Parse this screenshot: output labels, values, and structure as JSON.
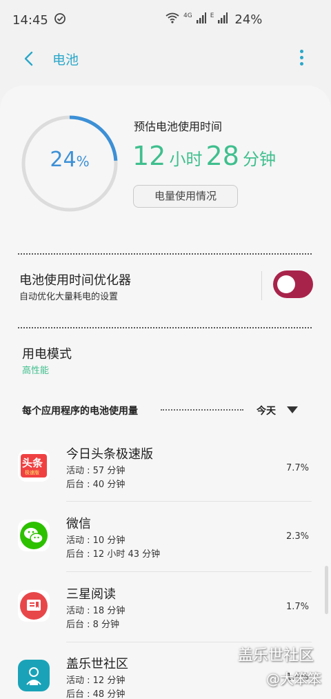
{
  "status_bar": {
    "time": "14:45",
    "network_small": "4G",
    "network_sub": "E",
    "battery_percent": "24%"
  },
  "header": {
    "title": "电池",
    "accent_color": "#2aa7c9"
  },
  "battery": {
    "level_value": "24",
    "level_unit": "%",
    "level_fraction": 0.24,
    "estimate_label": "预估电池使用时间",
    "hours": "12",
    "hours_unit": "小时",
    "minutes": "28",
    "minutes_unit": "分钟",
    "usage_button": "电量使用情况"
  },
  "optimizer": {
    "title": "电池使用时间优化器",
    "subtitle": "自动优化大量耗电的设置",
    "enabled": true
  },
  "power_mode": {
    "title": "用电模式",
    "value": "高性能",
    "value_color": "#3fbf8e"
  },
  "app_usage": {
    "label": "每个应用程序的电池使用量",
    "period": "今天",
    "apps": [
      {
        "name": "今日头条极速版",
        "active": "活动 : 57 分钟",
        "background": "后台 : 40 分钟",
        "percent": "7.7%",
        "icon": "toutiao-icon"
      },
      {
        "name": "微信",
        "active": "活动 : 10 分钟",
        "background": "后台 : 12 小时 43 分钟",
        "percent": "2.3%",
        "icon": "wechat-icon"
      },
      {
        "name": "三星阅读",
        "active": "活动 : 18 分钟",
        "background": "后台 : 8 分钟",
        "percent": "1.7%",
        "icon": "samsung-reader-icon"
      },
      {
        "name": "盖乐世社区",
        "active": "活动 : 12 分钟",
        "background": "后台 : 48 分钟",
        "percent": "1.4%",
        "icon": "galaxy-community-icon"
      }
    ]
  },
  "toutiao_icon_text": {
    "main": "头条",
    "sub": "极速版"
  },
  "watermark": {
    "line1": "盖乐世社区",
    "line2": "@大笨笨"
  }
}
